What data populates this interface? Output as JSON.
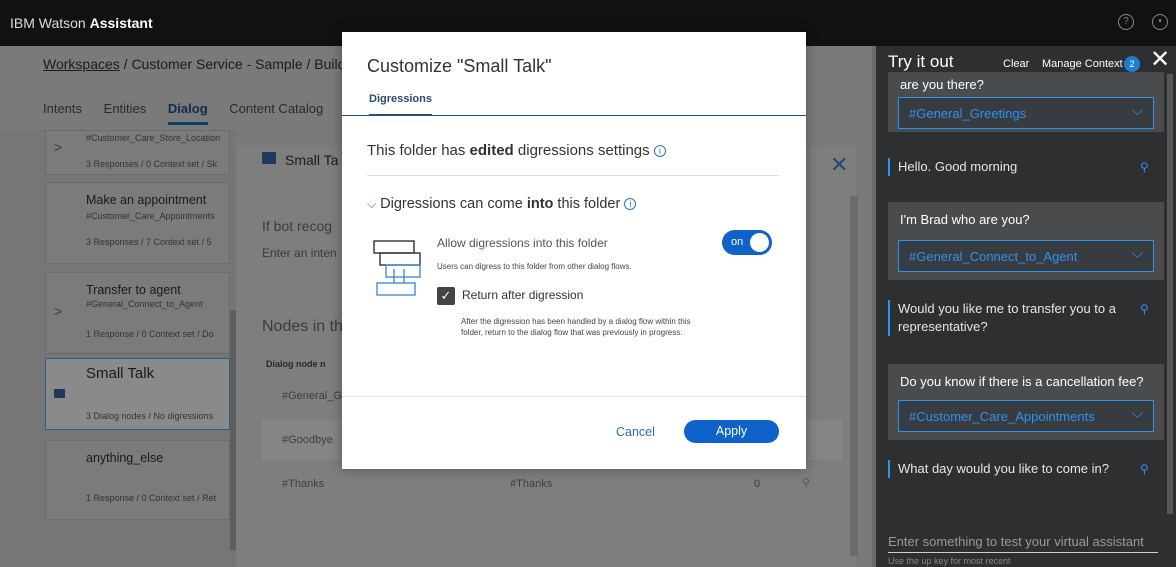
{
  "app": {
    "brand_prefix": "IBM Watson",
    "brand_name": "Assistant",
    "help_icon": "help-icon",
    "user_icon": "user-icon"
  },
  "workspace": {
    "breadcrumb": {
      "root": "Workspaces",
      "rest": " / Customer Service - Sample / Build"
    },
    "tabs": [
      "Intents",
      "Entities",
      "Dialog",
      "Content Catalog"
    ],
    "active_tab": "Dialog",
    "nodes": [
      {
        "title": "",
        "sub": "#Customer_Care_Store_Location",
        "meta": "3 Responses / 0 Context set / Sk"
      },
      {
        "title": "Make an appointment",
        "sub": "#Customer_Care_Appointments",
        "meta": "3 Responses / 7 Context set / 5"
      },
      {
        "title": "Transfer to agent",
        "sub": "#General_Connect_to_Agent",
        "meta": "1 Response / 0 Context set / Do"
      },
      {
        "title": "Small Talk",
        "sub": "",
        "meta": "3 Dialog nodes / No digressions"
      },
      {
        "title": "anything_else",
        "sub": "",
        "meta": "1 Response / 0 Context set / Ret"
      }
    ],
    "panel": {
      "title": "Small Ta",
      "if_bot": "If bot recog",
      "enter_intent": "Enter an inten",
      "nodes_in": "Nodes in th",
      "col_header": "Dialog node n",
      "rows": [
        {
          "a": "#General_G",
          "b": "",
          "c": ""
        },
        {
          "a": "#Goodbye",
          "b": "",
          "c": ""
        },
        {
          "a": "#Thanks",
          "b": "#Thanks",
          "c": "0"
        }
      ]
    }
  },
  "tryit": {
    "title": "Try it out",
    "clear": "Clear",
    "manage_context": "Manage Context",
    "context_count": "2",
    "close_icon": "close-icon",
    "partial_msg": "are you there?",
    "messages": [
      {
        "type": "intent",
        "value": "#General_Greetings"
      },
      {
        "type": "bot",
        "text": "Hello. Good morning"
      },
      {
        "type": "user",
        "text": "I'm Brad who are you?",
        "intent": "#General_Connect_to_Agent"
      },
      {
        "type": "bot",
        "text": "Would you like me to transfer you to a representative?"
      },
      {
        "type": "user",
        "text": "Do you know if there is a cancellation fee?",
        "intent": "#Customer_Care_Appointments"
      },
      {
        "type": "bot",
        "text": "What day would you like to come in?"
      }
    ],
    "input_placeholder": "Enter something to test your virtual assistant",
    "hint": "Use the up key for most recent"
  },
  "modal": {
    "title": "Customize \"Small Talk\"",
    "tab": "Digressions",
    "subtitle_pre": "This folder has ",
    "subtitle_bold": "edited",
    "subtitle_post": " digressions settings",
    "section_pre": "Digressions can come ",
    "section_bold": "into",
    "section_post": " this folder",
    "allow_label": "Allow digressions into this folder",
    "allow_desc": "Users can digress to this folder from other dialog flows.",
    "toggle": "on",
    "return_label": "Return after digression",
    "return_desc": "After the digression has been handled by a dialog flow within this folder, return to the dialog flow that was previously in progress.",
    "cancel": "Cancel",
    "apply": "Apply",
    "accent": "#0f62c9"
  }
}
